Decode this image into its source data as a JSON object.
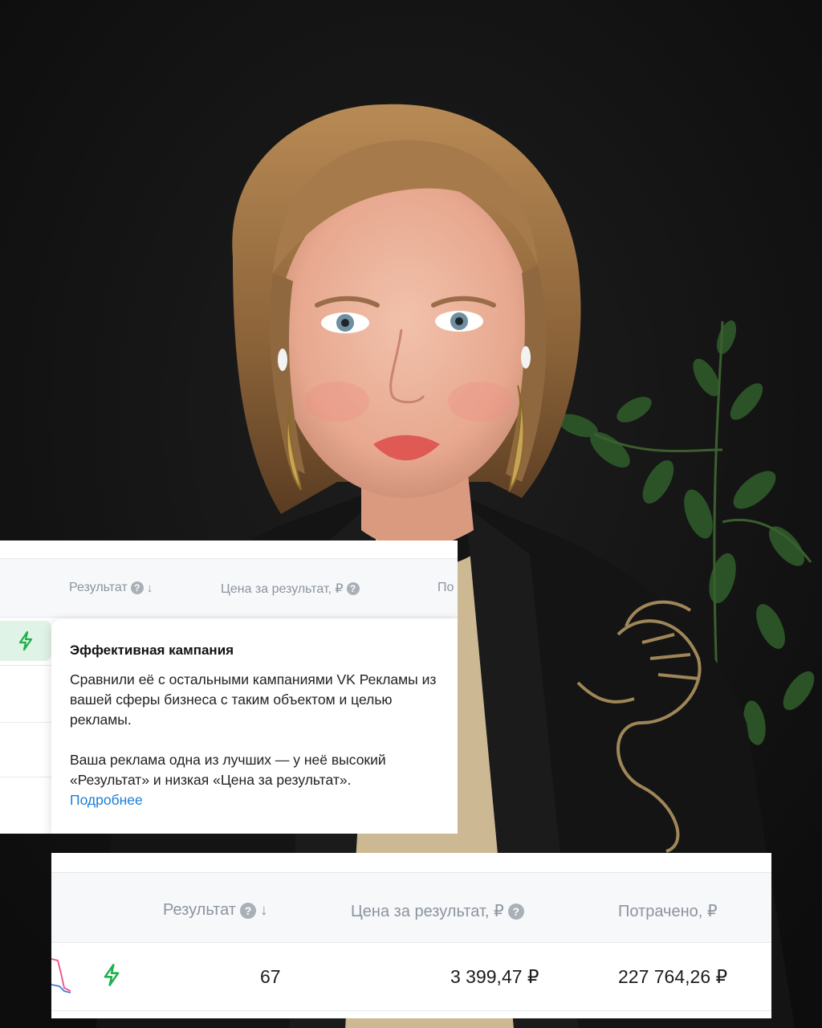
{
  "panel_top": {
    "columns": {
      "result": "Результат",
      "price_per_result": "Цена за результат, ₽",
      "cut_column": "По"
    },
    "tooltip": {
      "title": "Эффективная кампания",
      "paragraph1": "Сравнили её с остальными кампаниями VK Рекламы из вашей сферы бизнеса с таким объектом и целью рекламы.",
      "paragraph2": "Ваша реклама одна из лучших — у неё высокий «Результат» и низкая «Цена за результат».",
      "link": "Подробнее"
    }
  },
  "panel_bottom": {
    "columns": {
      "result": "Результат",
      "price_per_result": "Цена за результат, ₽",
      "spent": "Потрачено, ₽"
    },
    "row": {
      "result": "67",
      "price_per_result": "3 399,47 ₽",
      "spent": "227 764,26 ₽"
    }
  },
  "icons": {
    "help": "question-circle-icon",
    "sort": "sort-down-arrow-icon",
    "efficient": "lightning-bolt-icon"
  },
  "colors": {
    "accent_green": "#1eb04c",
    "link_blue": "#1a7ed6",
    "badge_bg": "#dff3e6"
  }
}
